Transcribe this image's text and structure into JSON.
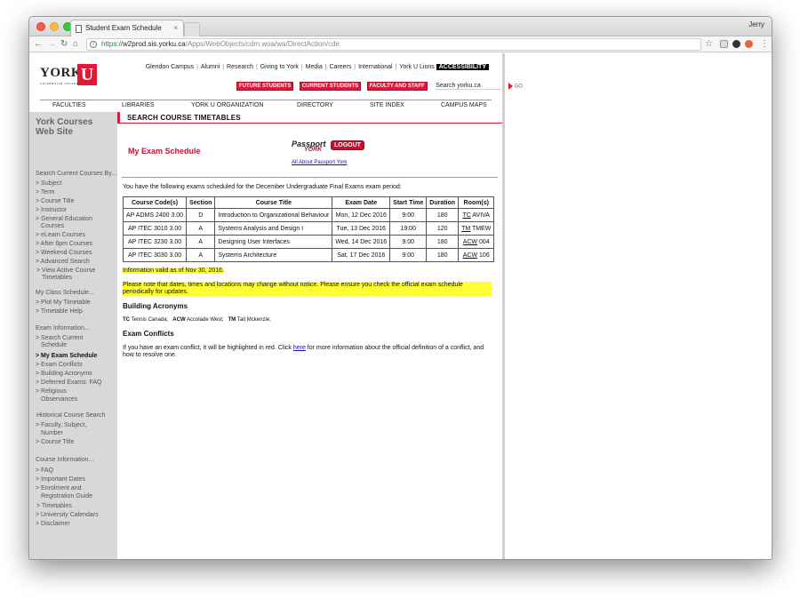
{
  "browser": {
    "tab_title": "Student Exam Schedule",
    "tab_close": "×",
    "user": "Jerry",
    "url_protocol": "https://",
    "url_host": "w2prod.sis.yorku.ca",
    "url_path": "/Apps/WebObjects/cdm.woa/wa/DirectAction/cde",
    "nav_back": "←",
    "nav_forward": "→",
    "nav_reload": "↻",
    "nav_home": "⌂",
    "star": "☆",
    "menu": "⋮"
  },
  "logo": {
    "york": "YORK",
    "u": "U",
    "sub": "UNIVERSITÉ UNIVERSITY"
  },
  "top_links": [
    "Glendon Campus",
    "Alumni",
    "Research",
    "Giving to York",
    "Media",
    "Careers",
    "International",
    "York U Lions"
  ],
  "accessibility": "ACCESSIBILITY",
  "audience_buttons": [
    "FUTURE STUDENTS",
    "CURRENT STUDENTS",
    "FACULTY AND STAFF"
  ],
  "search_label": "Search yorku.ca",
  "go_label": "GO",
  "main_nav": [
    "FACULTIES",
    "LIBRARIES",
    "YORK U ORGANIZATION",
    "DIRECTORY",
    "SITE INDEX",
    "CAMPUS MAPS"
  ],
  "sidebar": {
    "title1": "York Courses",
    "title2": "Web Site",
    "search_head": "Search Current Courses By...",
    "search_items": [
      "> Subject",
      "> Term",
      "> Course Title",
      "> Instructor",
      "> General Education",
      "Courses",
      "> eLearn Courses",
      "> After 6pm Courses",
      "> Weekend Courses",
      "> Advanced Search",
      "> View Active Course",
      "Timetables"
    ],
    "class_head": "My Class Schedule...",
    "class_items": [
      "> Plot My Timetable",
      "> Timetable Help"
    ],
    "exam_head": "Exam Information...",
    "exam_items": [
      "> Search Current",
      "Schedule",
      "> My Exam Schedule",
      "> Exam Conflicts",
      "> Building Acronyms",
      "> Deferred Exams: FAQ",
      "> Religious",
      "Observances"
    ],
    "hist_head": "Historical Course Search",
    "hist_items": [
      "> Faculty, Subject,",
      "Number",
      "> Course Title"
    ],
    "info_head": "Course Information...",
    "info_items": [
      "> FAQ",
      "> Important Dates",
      "> Enrolment and",
      "Registration Guide",
      "> Timetables",
      "> University Calendars",
      "> Disclaimer"
    ]
  },
  "section_header": "SEARCH COURSE TIMETABLES",
  "page_title": "My Exam Schedule",
  "passport": {
    "word1": "Passport",
    "word2": "YORK",
    "logout": "LOGOUT",
    "about": "All About Passport York"
  },
  "intro_text": "You have the following exams scheduled for the December Undergraduate Final Exams exam period:",
  "table": {
    "headers": [
      "Course Code(s)",
      "Section",
      "Course Title",
      "Exam Date",
      "Start Time",
      "Duration",
      "Room(s)"
    ],
    "rows": [
      [
        "AP ADMS 2400 3.00",
        "D",
        "Introduction to Organizational Behaviour",
        "Mon, 12 Dec 2016",
        "9:00",
        "180",
        "TC",
        "AVIVA"
      ],
      [
        "AP ITEC 3010 3.00",
        "A",
        "Systems Analysis and Design I",
        "Tue, 13 Dec 2016",
        "19:00",
        "120",
        "TM",
        "TMEW"
      ],
      [
        "AP ITEC 3230 3.00",
        "A",
        "Designing User Interfaces",
        "Wed, 14 Dec 2016",
        "9:00",
        "180",
        "ACW",
        "004"
      ],
      [
        "AP ITEC 3030 3.00",
        "A",
        "Systems Architecture",
        "Sat, 17 Dec 2016",
        "9:00",
        "180",
        "ACW",
        "106"
      ]
    ]
  },
  "info_valid": "Information valid as of Nov 30, 2016.",
  "notice": "Please note that dates, times and locations may change without notice. Please ensure you check the official exam schedule periodically for updates.",
  "building_heading": "Building Acronyms",
  "acronyms": [
    {
      "code": "TC",
      "name": "Tennis Canada;"
    },
    {
      "code": "ACW",
      "name": "Accolade West;"
    },
    {
      "code": "TM",
      "name": "Tait Mckenzie;"
    }
  ],
  "conflicts_heading": "Exam Conflicts",
  "conflicts_text_before": "If you have an exam conflict, it will be highlighted in red. Click ",
  "conflicts_link": "here",
  "conflicts_text_after": " for more information about the official definition of a conflict, and how to resolve one.",
  "colors": {
    "brand_red": "#e31837",
    "highlight": "#ffff33",
    "link": "#1a0dab"
  }
}
